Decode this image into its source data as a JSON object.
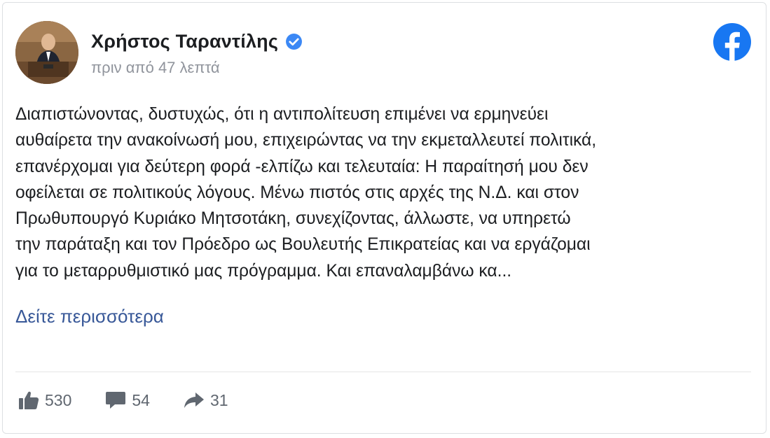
{
  "post": {
    "author": {
      "name": "Χρήστος Ταραντίλης",
      "verified_icon": "verified-badge-icon",
      "avatar_icon": "profile-photo"
    },
    "timestamp": "πριν από 47 λεπτά",
    "platform_icon": "facebook-logo-icon",
    "body_lines": [
      "Διαπιστώνοντας, δυστυχώς, ότι η αντιπολίτευση επιμένει να ερμηνεύει",
      "αυθαίρετα την ανακοίνωσή μου, επιχειρώντας να την εκμεταλλευτεί πολιτικά,",
      "επανέρχομαι για δεύτερη φορά -ελπίζω και τελευταία: Η παραίτησή μου δεν",
      "οφείλεται σε πολιτικούς λόγους. Μένω πιστός στις αρχές της Ν.Δ. και στον",
      "Πρωθυπουργό Κυριάκο Μητσοτάκη, συνεχίζοντας, άλλωστε, να υπηρετώ",
      "την παράταξη και τον Πρόεδρο ως Βουλευτής Επικρατείας και να εργάζομαι",
      "για το μεταρρυθμιστικό μας πρόγραμμα. Και επαναλαμβάνω κα..."
    ],
    "see_more": "Δείτε περισσότερα",
    "stats": {
      "likes": "530",
      "comments": "54",
      "shares": "31"
    },
    "colors": {
      "facebook_blue": "#1877f2",
      "link": "#385898",
      "muted": "#90949c",
      "icon_gray": "#606770"
    }
  }
}
